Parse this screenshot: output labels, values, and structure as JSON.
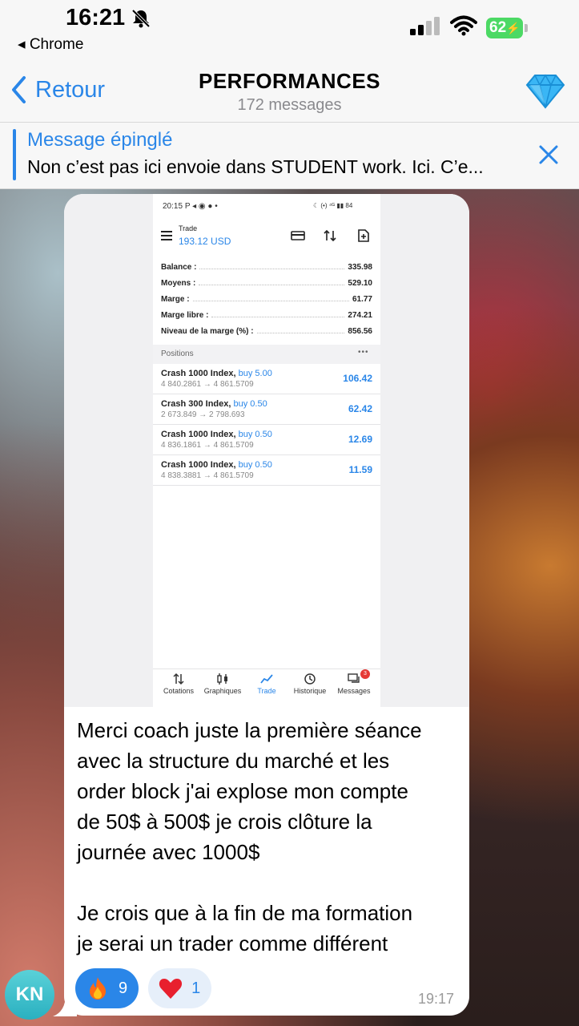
{
  "status_bar": {
    "time": "16:21",
    "back_app": "◂ Chrome",
    "battery": "62"
  },
  "header": {
    "back_label": "Retour",
    "title": "PERFORMANCES",
    "subtitle": "172 messages"
  },
  "pinned": {
    "title": "Message épinglé",
    "text": "Non c’est pas ici envoie dans STUDENT work. Ici. C’e..."
  },
  "screenshot": {
    "status_time": "20:15",
    "status_left_icons": "P ◂ ◉ ● •",
    "status_right": "☾ (•) ⁴ᴳ ▮▮ 84",
    "trade_label": "Trade",
    "trade_amount": "193.12 USD",
    "account": [
      {
        "label": "Balance :",
        "value": "335.98"
      },
      {
        "label": "Moyens :",
        "value": "529.10"
      },
      {
        "label": "Marge :",
        "value": "61.77"
      },
      {
        "label": "Marge libre :",
        "value": "274.21"
      },
      {
        "label": "Niveau de la marge (%) :",
        "value": "856.56"
      }
    ],
    "positions_title": "Positions",
    "positions_more": "•••",
    "positions": [
      {
        "name": "Crash 1000 Index,",
        "dir": "buy 5.00",
        "prices": "4 840.2861 → 4 861.5709",
        "profit": "106.42"
      },
      {
        "name": "Crash 300 Index,",
        "dir": "buy 0.50",
        "prices": "2 673.849 → 2 798.693",
        "profit": "62.42"
      },
      {
        "name": "Crash 1000 Index,",
        "dir": "buy 0.50",
        "prices": "4 836.1861 → 4 861.5709",
        "profit": "12.69"
      },
      {
        "name": "Crash 1000 Index,",
        "dir": "buy 0.50",
        "prices": "4 838.3881 → 4 861.5709",
        "profit": "11.59"
      }
    ],
    "tabs": [
      {
        "label": "Cotations"
      },
      {
        "label": "Graphiques"
      },
      {
        "label": "Trade"
      },
      {
        "label": "Historique"
      },
      {
        "label": "Messages",
        "badge": "3"
      }
    ]
  },
  "message": {
    "text": "Merci coach juste la première séance\navec la structure du marché et les\norder block j'ai explose mon compte\nde 50$ à 500$ je crois clôture la\njournée avec 1000$\n\nJe crois que à la fin de ma formation\nje serai un trader comme différent",
    "time": "19:17",
    "reactions": [
      {
        "emoji": "fire-emoji",
        "count": "9"
      },
      {
        "emoji": "heart-emoji",
        "count": "1"
      }
    ]
  },
  "avatar": {
    "initials": "KN"
  },
  "colors": {
    "accent": "#2a86e8",
    "battery": "#4cd964"
  }
}
